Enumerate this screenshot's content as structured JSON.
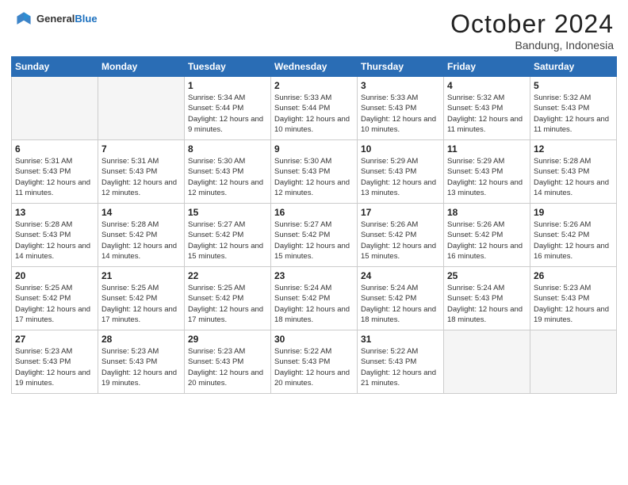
{
  "header": {
    "logo_general": "General",
    "logo_blue": "Blue",
    "month": "October 2024",
    "location": "Bandung, Indonesia"
  },
  "days_of_week": [
    "Sunday",
    "Monday",
    "Tuesday",
    "Wednesday",
    "Thursday",
    "Friday",
    "Saturday"
  ],
  "weeks": [
    [
      {
        "day": "",
        "info": ""
      },
      {
        "day": "",
        "info": ""
      },
      {
        "day": "1",
        "info": "Sunrise: 5:34 AM\nSunset: 5:44 PM\nDaylight: 12 hours and 9 minutes."
      },
      {
        "day": "2",
        "info": "Sunrise: 5:33 AM\nSunset: 5:44 PM\nDaylight: 12 hours and 10 minutes."
      },
      {
        "day": "3",
        "info": "Sunrise: 5:33 AM\nSunset: 5:43 PM\nDaylight: 12 hours and 10 minutes."
      },
      {
        "day": "4",
        "info": "Sunrise: 5:32 AM\nSunset: 5:43 PM\nDaylight: 12 hours and 11 minutes."
      },
      {
        "day": "5",
        "info": "Sunrise: 5:32 AM\nSunset: 5:43 PM\nDaylight: 12 hours and 11 minutes."
      }
    ],
    [
      {
        "day": "6",
        "info": "Sunrise: 5:31 AM\nSunset: 5:43 PM\nDaylight: 12 hours and 11 minutes."
      },
      {
        "day": "7",
        "info": "Sunrise: 5:31 AM\nSunset: 5:43 PM\nDaylight: 12 hours and 12 minutes."
      },
      {
        "day": "8",
        "info": "Sunrise: 5:30 AM\nSunset: 5:43 PM\nDaylight: 12 hours and 12 minutes."
      },
      {
        "day": "9",
        "info": "Sunrise: 5:30 AM\nSunset: 5:43 PM\nDaylight: 12 hours and 12 minutes."
      },
      {
        "day": "10",
        "info": "Sunrise: 5:29 AM\nSunset: 5:43 PM\nDaylight: 12 hours and 13 minutes."
      },
      {
        "day": "11",
        "info": "Sunrise: 5:29 AM\nSunset: 5:43 PM\nDaylight: 12 hours and 13 minutes."
      },
      {
        "day": "12",
        "info": "Sunrise: 5:28 AM\nSunset: 5:43 PM\nDaylight: 12 hours and 14 minutes."
      }
    ],
    [
      {
        "day": "13",
        "info": "Sunrise: 5:28 AM\nSunset: 5:43 PM\nDaylight: 12 hours and 14 minutes."
      },
      {
        "day": "14",
        "info": "Sunrise: 5:28 AM\nSunset: 5:42 PM\nDaylight: 12 hours and 14 minutes."
      },
      {
        "day": "15",
        "info": "Sunrise: 5:27 AM\nSunset: 5:42 PM\nDaylight: 12 hours and 15 minutes."
      },
      {
        "day": "16",
        "info": "Sunrise: 5:27 AM\nSunset: 5:42 PM\nDaylight: 12 hours and 15 minutes."
      },
      {
        "day": "17",
        "info": "Sunrise: 5:26 AM\nSunset: 5:42 PM\nDaylight: 12 hours and 15 minutes."
      },
      {
        "day": "18",
        "info": "Sunrise: 5:26 AM\nSunset: 5:42 PM\nDaylight: 12 hours and 16 minutes."
      },
      {
        "day": "19",
        "info": "Sunrise: 5:26 AM\nSunset: 5:42 PM\nDaylight: 12 hours and 16 minutes."
      }
    ],
    [
      {
        "day": "20",
        "info": "Sunrise: 5:25 AM\nSunset: 5:42 PM\nDaylight: 12 hours and 17 minutes."
      },
      {
        "day": "21",
        "info": "Sunrise: 5:25 AM\nSunset: 5:42 PM\nDaylight: 12 hours and 17 minutes."
      },
      {
        "day": "22",
        "info": "Sunrise: 5:25 AM\nSunset: 5:42 PM\nDaylight: 12 hours and 17 minutes."
      },
      {
        "day": "23",
        "info": "Sunrise: 5:24 AM\nSunset: 5:42 PM\nDaylight: 12 hours and 18 minutes."
      },
      {
        "day": "24",
        "info": "Sunrise: 5:24 AM\nSunset: 5:42 PM\nDaylight: 12 hours and 18 minutes."
      },
      {
        "day": "25",
        "info": "Sunrise: 5:24 AM\nSunset: 5:43 PM\nDaylight: 12 hours and 18 minutes."
      },
      {
        "day": "26",
        "info": "Sunrise: 5:23 AM\nSunset: 5:43 PM\nDaylight: 12 hours and 19 minutes."
      }
    ],
    [
      {
        "day": "27",
        "info": "Sunrise: 5:23 AM\nSunset: 5:43 PM\nDaylight: 12 hours and 19 minutes."
      },
      {
        "day": "28",
        "info": "Sunrise: 5:23 AM\nSunset: 5:43 PM\nDaylight: 12 hours and 19 minutes."
      },
      {
        "day": "29",
        "info": "Sunrise: 5:23 AM\nSunset: 5:43 PM\nDaylight: 12 hours and 20 minutes."
      },
      {
        "day": "30",
        "info": "Sunrise: 5:22 AM\nSunset: 5:43 PM\nDaylight: 12 hours and 20 minutes."
      },
      {
        "day": "31",
        "info": "Sunrise: 5:22 AM\nSunset: 5:43 PM\nDaylight: 12 hours and 21 minutes."
      },
      {
        "day": "",
        "info": ""
      },
      {
        "day": "",
        "info": ""
      }
    ]
  ]
}
